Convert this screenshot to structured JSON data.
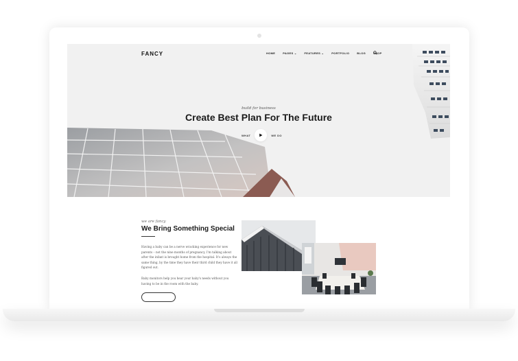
{
  "site": {
    "logo": "FANCY"
  },
  "nav": {
    "items": [
      {
        "label": "HOME"
      },
      {
        "label": "PAGES ⌄"
      },
      {
        "label": "FEATURES ⌄"
      },
      {
        "label": "PORTFOLIO"
      },
      {
        "label": "BLOG"
      },
      {
        "label": "SHOP"
      }
    ],
    "search_icon": "search-icon"
  },
  "hero": {
    "subtitle": "build for business",
    "title": "Create Best Plan For The Future",
    "play_left": "WHAT",
    "play_right": "WE DO",
    "play_icon": "play-icon"
  },
  "intro": {
    "eyebrow": "we are fancy",
    "title": "We Bring Something Special",
    "paragraph_1": "Having a baby can be a nerve wracking experience for new parents – not the nine months of pregnancy, I'm talking about after the infant is brought home from the hospital. It's always the same thing, by the time they have their third child they have it all figured out.",
    "paragraph_2": "Baby monitors help you hear your baby's needs without you having to be in the room with the baby."
  },
  "colors": {
    "accent": "#1a1a1a",
    "hero_bg": "#f1f1f1"
  }
}
